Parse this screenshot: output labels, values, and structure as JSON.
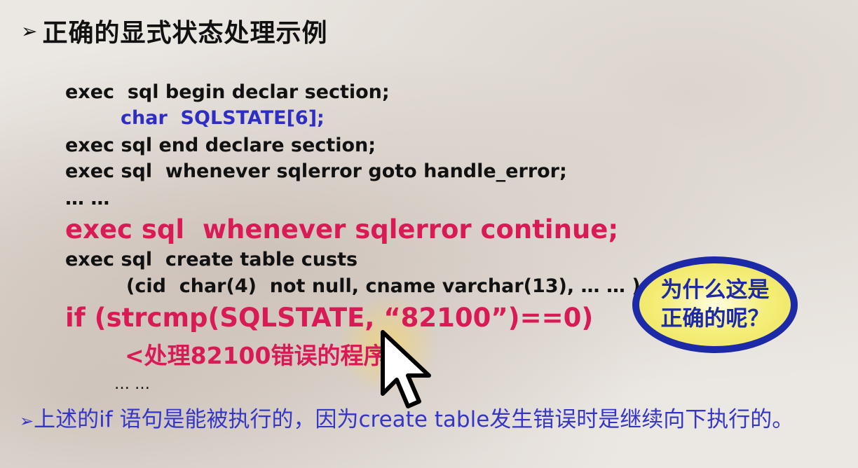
{
  "title": {
    "arrow": "➢",
    "text": "正确的显式状态处理示例"
  },
  "code": [
    "exec  sql begin declar section;",
    "char  SQLSTATE[6];",
    "exec sql end declare section;",
    "exec sql  whenever sqlerror goto handle_error;",
    "… …",
    "exec sql  whenever sqlerror continue;",
    "exec sql  create table custs",
    "(cid  char(4)  not null, cname varchar(13), … … );",
    "if (strcmp(SQLSTATE, “82100”)==0)",
    "<处理82100错误的程序>",
    "… …"
  ],
  "bubble": {
    "line1": "为什么这是",
    "line2": "正确的呢？"
  },
  "note": {
    "arrow": "➢",
    "text": "上述的if 语句是能被执行的，因为create table发生错误时是继续向下执行的。"
  },
  "colors": {
    "keyword_blue": "#2e2ec4",
    "highlight_red": "#d81a55",
    "note_blue": "#3535c8",
    "bubble_border": "#1c2aa8",
    "bubble_fill": "#f5ef7d"
  },
  "icons": {
    "cursor": "mouse-pointer-icon"
  }
}
